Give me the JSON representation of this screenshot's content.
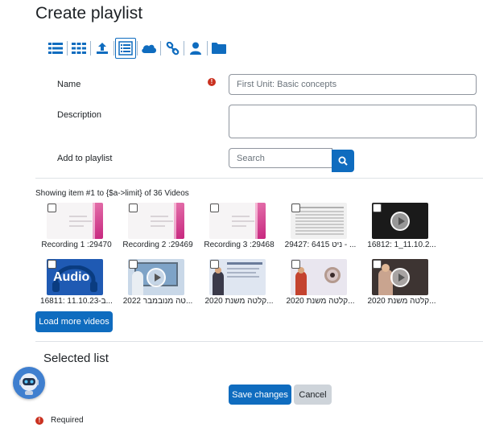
{
  "page": {
    "title": "Create playlist"
  },
  "toolbar": {
    "icons": [
      "list-icon",
      "grid-icon",
      "upload-icon",
      "playlist-icon",
      "cloud-icon",
      "link-icon",
      "user-icon",
      "folder-icon"
    ],
    "accent": "#0f6cbf"
  },
  "form": {
    "name_label": "Name",
    "name_placeholder": "First Unit: Basic concepts",
    "description_label": "Description",
    "description_value": "",
    "add_label": "Add to playlist",
    "search_placeholder": "Search"
  },
  "videos": {
    "showing_text": "Showing item #1 to {$a->limit} of 36 Videos",
    "items": [
      {
        "caption": "Recording 1 :29470"
      },
      {
        "caption": "Recording 2 :29469"
      },
      {
        "caption": "Recording 3 :29468"
      },
      {
        "caption": "29427: 6415 ניט - ..."
      },
      {
        "caption": "16812: 1_11.10.2..."
      },
      {
        "caption": "16811: 11.10.23-ב..."
      },
      {
        "caption": "2022 טה מנובמבר..."
      },
      {
        "caption": "2020 קלטה משנת..."
      },
      {
        "caption": "2020 קלטה משנת..."
      },
      {
        "caption": "2020 קלטה משנת..."
      }
    ],
    "audio_label": "Audio",
    "load_more_label": "Load more videos"
  },
  "selected": {
    "title": "Selected list"
  },
  "actions": {
    "save_label": "Save changes",
    "cancel_label": "Cancel"
  },
  "footer": {
    "required_label": "Required"
  },
  "colors": {
    "primary": "#0f6cbf",
    "required": "#ca3120",
    "secondary": "#ced4da"
  }
}
